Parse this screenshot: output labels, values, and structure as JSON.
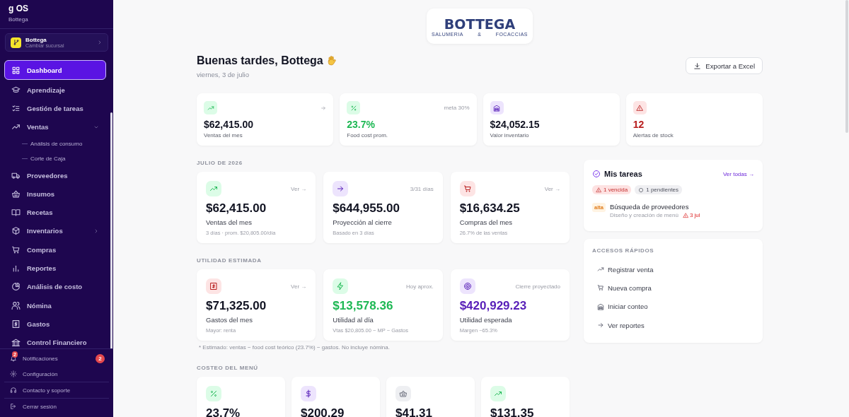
{
  "sidebar": {
    "brand": "g OS",
    "brand_sub": "Bottega",
    "branch": {
      "name": "Bottega",
      "action": "Cambiar sucursal"
    },
    "nav": [
      {
        "label": "Dashboard",
        "selected": true
      },
      {
        "label": "Aprendizaje",
        "selected": false
      },
      {
        "label": "Gestión de tareas",
        "selected": false
      },
      {
        "label": "Ventas",
        "selected": false,
        "expanded": true,
        "children": [
          {
            "label": "Análisis de consumo",
            "selected": false
          },
          {
            "label": "Corte de Caja",
            "selected": false
          }
        ]
      },
      {
        "label": "Proveedores",
        "selected": false
      },
      {
        "label": "Insumos",
        "selected": false
      },
      {
        "label": "Recetas",
        "selected": false
      },
      {
        "label": "Inventarios",
        "selected": false,
        "expanded": false
      },
      {
        "label": "Compras",
        "selected": false
      },
      {
        "label": "Reportes",
        "selected": false
      },
      {
        "label": "Análisis de costo",
        "selected": false
      },
      {
        "label": "Nómina",
        "selected": false
      },
      {
        "label": "Gastos",
        "selected": false
      },
      {
        "label": "Control Financiero",
        "selected": false
      }
    ],
    "footer": [
      {
        "label": "Notificaciones",
        "icon_badge": "2",
        "badge": "2"
      },
      {
        "label": "Configuración"
      },
      {
        "label": "Contacto y soporte"
      },
      {
        "label": "Cerrar sesión"
      }
    ]
  },
  "logo": {
    "name": "BOTTEGA",
    "tagline": [
      "SALUMERIA",
      "&",
      "FOCACCIAS"
    ]
  },
  "greeting": {
    "title": "Buenas tardes, Bottega",
    "date": "viernes, 3 de julio"
  },
  "export_button": "Exportar a Excel",
  "summary": [
    {
      "value": "$62,415.00",
      "label": "Ventas del mes",
      "color": "#dcfce7",
      "accent_value": false,
      "arrow": true
    },
    {
      "value": "23.7%",
      "label": "Food cost prom.",
      "color": "#dcfce7",
      "accent_value": true,
      "note": "meta 30%"
    },
    {
      "value": "$24,052.15",
      "label": "Valor inventario",
      "color": "#ede4fd",
      "accent_value": false
    },
    {
      "value": "12",
      "label": "Alertas de stock",
      "color": "#fde4e4",
      "accent_value": true
    }
  ],
  "sections": [
    {
      "title": "JULIO DE 2026",
      "cards": [
        {
          "value": "$62,415.00",
          "label": "Ventas del mes",
          "sub": "3 días · prom. $20,805.00/día",
          "note": "Ver →",
          "color": "#dcfce7",
          "accent_value": false
        },
        {
          "value": "$644,955.00",
          "label": "Proyección al cierre",
          "sub": "Basado en 3 días",
          "note": "3/31 días",
          "color": "#ede4fd",
          "accent_value": false
        },
        {
          "value": "$16,634.25",
          "label": "Compras del mes",
          "sub": "26.7% de las ventas",
          "note": "Ver →",
          "color": "#fde4e4",
          "accent_value": false
        }
      ]
    },
    {
      "title": "UTILIDAD ESTIMADA",
      "cards": [
        {
          "value": "$71,325.00",
          "label": "Gastos del mes",
          "sub": "Mayor: renta",
          "note": "Ver →",
          "color": "#fde4e4",
          "accent_value": false
        },
        {
          "value": "$13,578.36",
          "label": "Utilidad al día",
          "sub": "Vtas $20,805.00 − MP − Gastos",
          "note": "Hoy aprox.",
          "color": "#dcfce7",
          "accent_value": true
        },
        {
          "value": "$420,929.23",
          "label": "Utilidad esperada",
          "sub": "Margen ~65.3%",
          "note": "Cierre proyectado",
          "color": "#ede4fd",
          "accent_value": true
        }
      ],
      "footnote": "* Estimado: ventas − food cost teórico (23.7%) − gastos. No incluye nómina."
    },
    {
      "title": "COSTEO DEL MENÚ",
      "cards": [
        {
          "value": "23.7%",
          "color": "#dcfce7",
          "accent_value": false
        },
        {
          "value": "$200.29",
          "color": "#ede4fd",
          "accent_value": false
        },
        {
          "value": "$41.31",
          "color": "#eeeff2",
          "accent_value": false
        },
        {
          "value": "$131.35",
          "color": "#dcfce7",
          "accent_value": false
        }
      ]
    }
  ],
  "tasks": {
    "title": "Mis tareas",
    "link": "Ver todas →",
    "chips": [
      {
        "kind": "overdue",
        "label": "1 vencida"
      },
      {
        "kind": "pending",
        "label": "1 pendientes"
      }
    ],
    "items": [
      {
        "priority": "alta",
        "title": "Búsqueda de proveedores",
        "project": "Diseño y creación de menú",
        "due": "3 jul",
        "overdue": true
      }
    ]
  },
  "quick": {
    "title": "ACCESOS RÁPIDOS",
    "items": [
      "Registrar venta",
      "Nueva compra",
      "Iniciar conteo",
      "Ver reportes"
    ]
  }
}
